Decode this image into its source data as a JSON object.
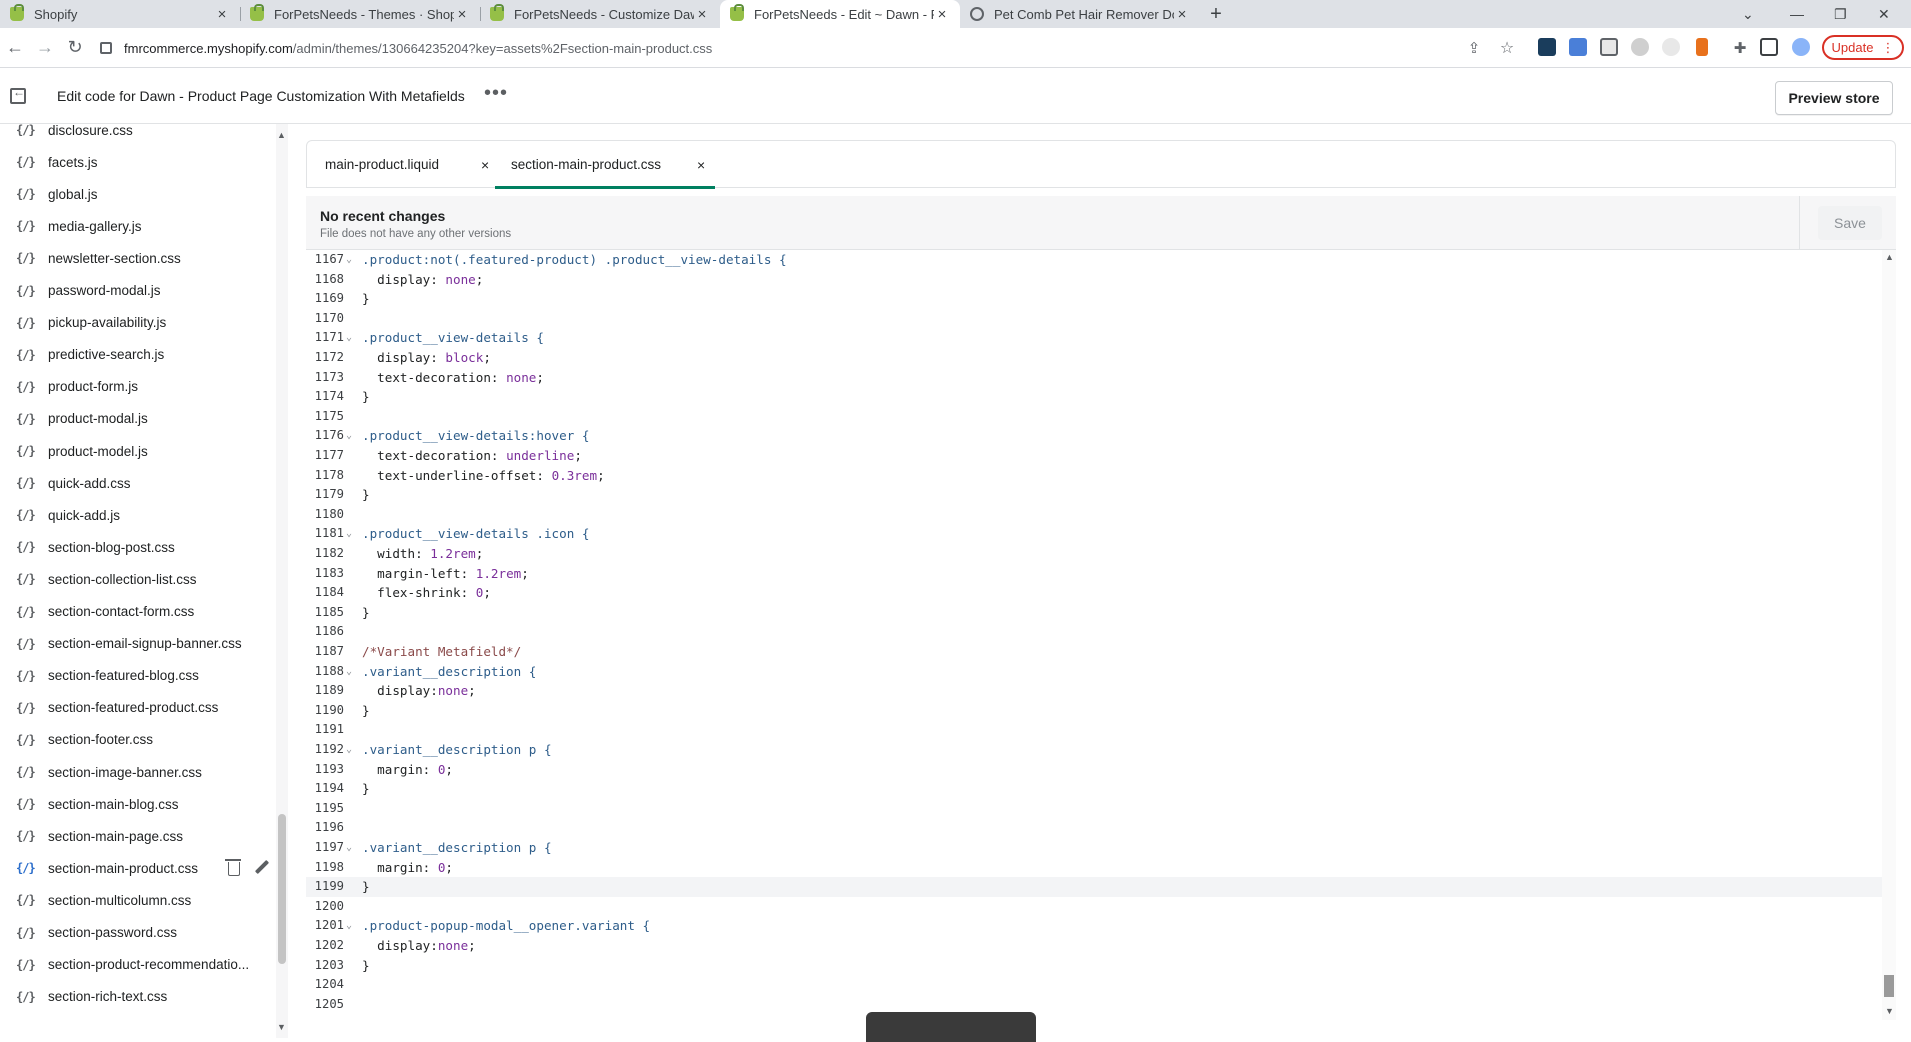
{
  "browser": {
    "tabs": [
      {
        "title": "Shopify",
        "icon": "shopify-icon",
        "active": false
      },
      {
        "title": "ForPetsNeeds - Themes · Shopify",
        "icon": "shopify-icon",
        "active": false
      },
      {
        "title": "ForPetsNeeds - Customize Dawn",
        "icon": "shopify-icon",
        "active": false
      },
      {
        "title": "ForPetsNeeds - Edit ~ Dawn - Pr",
        "icon": "shopify-icon",
        "active": true
      },
      {
        "title": "Pet Comb Pet Hair Remover Dog",
        "icon": "globe-icon",
        "active": false
      }
    ],
    "new_tab": "+",
    "url_host": "fmrcommerce.myshopify.com",
    "url_path": "/admin/themes/130664235204?key=assets%2Fsection-main-product.css",
    "update_label": "Update"
  },
  "header": {
    "title": "Edit code for Dawn - Product Page Customization With Metafields",
    "more": "•••",
    "preview_label": "Preview store"
  },
  "sidebar": {
    "file_icon": "{/}",
    "files": [
      "disclosure.css",
      "facets.js",
      "global.js",
      "media-gallery.js",
      "newsletter-section.css",
      "password-modal.js",
      "pickup-availability.js",
      "predictive-search.js",
      "product-form.js",
      "product-modal.js",
      "product-model.js",
      "quick-add.css",
      "quick-add.js",
      "section-blog-post.css",
      "section-collection-list.css",
      "section-contact-form.css",
      "section-email-signup-banner.css",
      "section-featured-blog.css",
      "section-featured-product.css",
      "section-footer.css",
      "section-image-banner.css",
      "section-main-blog.css",
      "section-main-page.css",
      "section-main-product.css",
      "section-multicolumn.css",
      "section-password.css",
      "section-product-recommendatio...",
      "section-rich-text.css"
    ],
    "selected_file": "section-main-product.css"
  },
  "editor_tabs": [
    {
      "label": "main-product.liquid",
      "close": "×",
      "active": false
    },
    {
      "label": "section-main-product.css",
      "close": "×",
      "active": true
    }
  ],
  "status": {
    "title": "No recent changes",
    "subtitle": "File does not have any other versions",
    "save_label": "Save"
  },
  "code": {
    "current_line": 1199,
    "lines": [
      {
        "n": "1167",
        "fold": true,
        "parts": [
          [
            "sel",
            ".product:not(.featured-product) .product__view-details {"
          ]
        ]
      },
      {
        "n": "1168",
        "parts": [
          [
            "prop",
            "  display: "
          ],
          [
            "val",
            "none"
          ],
          [
            "pun",
            ";"
          ]
        ]
      },
      {
        "n": "1169",
        "parts": [
          [
            "pun",
            "}"
          ]
        ]
      },
      {
        "n": "1170",
        "parts": []
      },
      {
        "n": "1171",
        "fold": true,
        "parts": [
          [
            "sel",
            ".product__view-details {"
          ]
        ]
      },
      {
        "n": "1172",
        "parts": [
          [
            "prop",
            "  display: "
          ],
          [
            "val",
            "block"
          ],
          [
            "pun",
            ";"
          ]
        ]
      },
      {
        "n": "1173",
        "parts": [
          [
            "prop",
            "  text-decoration: "
          ],
          [
            "val",
            "none"
          ],
          [
            "pun",
            ";"
          ]
        ]
      },
      {
        "n": "1174",
        "parts": [
          [
            "pun",
            "}"
          ]
        ]
      },
      {
        "n": "1175",
        "parts": []
      },
      {
        "n": "1176",
        "fold": true,
        "parts": [
          [
            "sel",
            ".product__view-details:hover {"
          ]
        ]
      },
      {
        "n": "1177",
        "parts": [
          [
            "prop",
            "  text-decoration: "
          ],
          [
            "val",
            "underline"
          ],
          [
            "pun",
            ";"
          ]
        ]
      },
      {
        "n": "1178",
        "parts": [
          [
            "prop",
            "  text-underline-offset: "
          ],
          [
            "val",
            "0.3rem"
          ],
          [
            "pun",
            ";"
          ]
        ]
      },
      {
        "n": "1179",
        "parts": [
          [
            "pun",
            "}"
          ]
        ]
      },
      {
        "n": "1180",
        "parts": []
      },
      {
        "n": "1181",
        "fold": true,
        "parts": [
          [
            "sel",
            ".product__view-details .icon {"
          ]
        ]
      },
      {
        "n": "1182",
        "parts": [
          [
            "prop",
            "  width: "
          ],
          [
            "val",
            "1.2rem"
          ],
          [
            "pun",
            ";"
          ]
        ]
      },
      {
        "n": "1183",
        "parts": [
          [
            "prop",
            "  margin-left: "
          ],
          [
            "val",
            "1.2rem"
          ],
          [
            "pun",
            ";"
          ]
        ]
      },
      {
        "n": "1184",
        "parts": [
          [
            "prop",
            "  flex-shrink: "
          ],
          [
            "val",
            "0"
          ],
          [
            "pun",
            ";"
          ]
        ]
      },
      {
        "n": "1185",
        "parts": [
          [
            "pun",
            "}"
          ]
        ]
      },
      {
        "n": "1186",
        "parts": []
      },
      {
        "n": "1187",
        "parts": [
          [
            "cm",
            "/*Variant Metafield*/"
          ]
        ]
      },
      {
        "n": "1188",
        "fold": true,
        "parts": [
          [
            "sel",
            ".variant__description {"
          ]
        ]
      },
      {
        "n": "1189",
        "parts": [
          [
            "prop",
            "  display:"
          ],
          [
            "val",
            "none"
          ],
          [
            "pun",
            ";"
          ]
        ]
      },
      {
        "n": "1190",
        "parts": [
          [
            "pun",
            "}"
          ]
        ]
      },
      {
        "n": "1191",
        "parts": []
      },
      {
        "n": "1192",
        "fold": true,
        "parts": [
          [
            "sel",
            ".variant__description p {"
          ]
        ]
      },
      {
        "n": "1193",
        "parts": [
          [
            "prop",
            "  margin: "
          ],
          [
            "val",
            "0"
          ],
          [
            "pun",
            ";"
          ]
        ]
      },
      {
        "n": "1194",
        "parts": [
          [
            "pun",
            "}"
          ]
        ]
      },
      {
        "n": "1195",
        "parts": []
      },
      {
        "n": "1196",
        "parts": []
      },
      {
        "n": "1197",
        "fold": true,
        "parts": [
          [
            "sel",
            ".variant__description p {"
          ]
        ]
      },
      {
        "n": "1198",
        "parts": [
          [
            "prop",
            "  margin: "
          ],
          [
            "val",
            "0"
          ],
          [
            "pun",
            ";"
          ]
        ]
      },
      {
        "n": "1199",
        "parts": [
          [
            "pun",
            "}"
          ]
        ]
      },
      {
        "n": "1200",
        "parts": []
      },
      {
        "n": "1201",
        "fold": true,
        "parts": [
          [
            "sel",
            ".product-popup-modal__opener.variant {"
          ]
        ]
      },
      {
        "n": "1202",
        "parts": [
          [
            "prop",
            "  display:"
          ],
          [
            "val",
            "none"
          ],
          [
            "pun",
            ";"
          ]
        ]
      },
      {
        "n": "1203",
        "parts": [
          [
            "pun",
            "}"
          ]
        ]
      },
      {
        "n": "1204",
        "parts": []
      },
      {
        "n": "1205",
        "parts": []
      }
    ]
  },
  "colors": {
    "accent_green": "#008060",
    "update_red": "#d93025",
    "selected_blue": "#2c6ecb"
  }
}
